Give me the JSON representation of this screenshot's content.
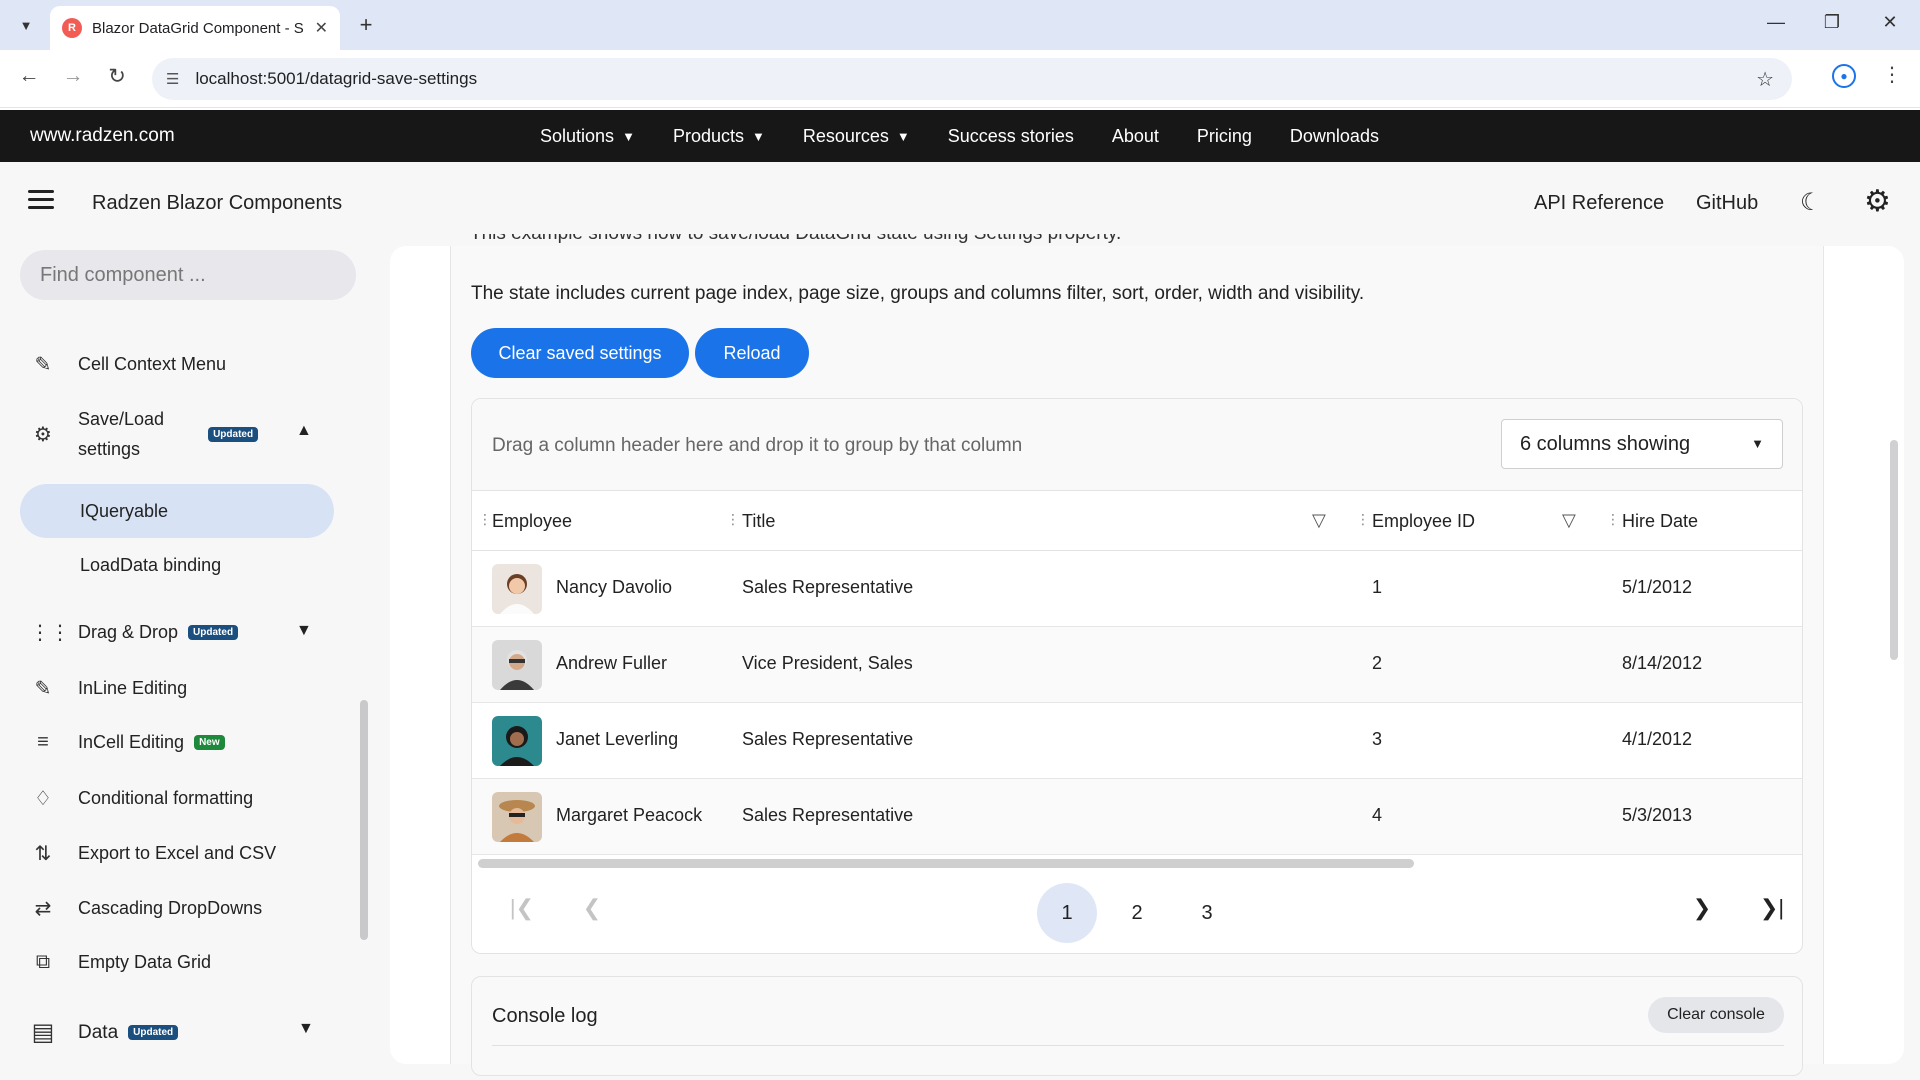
{
  "browser": {
    "tab_title": "Blazor DataGrid Component - S",
    "url": "localhost:5001/datagrid-save-settings"
  },
  "site": {
    "brand": "www.radzen.com",
    "menu": [
      "Solutions",
      "Products",
      "Resources",
      "Success stories",
      "About",
      "Pricing",
      "Downloads"
    ]
  },
  "header": {
    "title": "Radzen Blazor Components",
    "api_reference": "API Reference",
    "github": "GitHub"
  },
  "sidebar": {
    "search_placeholder": "Find component ...",
    "items": {
      "cell_context_menu": "Cell Context Menu",
      "save_load_line1": "Save/Load",
      "save_load_line2": "settings",
      "iqueryable": "IQueryable",
      "loaddata_binding": "LoadData binding",
      "drag_drop": "Drag & Drop",
      "inline_editing": "InLine Editing",
      "incell_editing": "InCell Editing",
      "conditional_formatting": "Conditional formatting",
      "export_excel_csv": "Export to Excel and CSV",
      "cascading_dropdowns": "Cascading DropDowns",
      "empty_data_grid": "Empty Data Grid",
      "data": "Data"
    },
    "badges": {
      "updated": "Updated",
      "new": "New"
    }
  },
  "main": {
    "cut_text": "This example shows how to save/load DataGrid state using Settings property.",
    "description": "The state includes current page index, page size, groups and columns filter, sort, order, width and visibility.",
    "clear_button": "Clear saved settings",
    "reload_button": "Reload"
  },
  "grid": {
    "group_hint": "Drag a column header here and drop it to group by that column",
    "columns_showing": "6 columns showing",
    "headers": {
      "employee": "Employee",
      "title": "Title",
      "employee_id": "Employee ID",
      "hire_date": "Hire Date"
    },
    "rows": [
      {
        "name": "Nancy Davolio",
        "title": "Sales Representative",
        "id": "1",
        "hire": "5/1/2012"
      },
      {
        "name": "Andrew Fuller",
        "title": "Vice President, Sales",
        "id": "2",
        "hire": "8/14/2012"
      },
      {
        "name": "Janet Leverling",
        "title": "Sales Representative",
        "id": "3",
        "hire": "4/1/2012"
      },
      {
        "name": "Margaret Peacock",
        "title": "Sales Representative",
        "id": "4",
        "hire": "5/3/2013"
      }
    ],
    "pages": [
      "1",
      "2",
      "3"
    ],
    "current_page": "1"
  },
  "console": {
    "title": "Console log",
    "clear": "Clear console"
  },
  "colors": {
    "accent": "#1a73e8",
    "sitebar": "#171717",
    "badge_updated": "#1a4f80",
    "badge_new": "#1c8a3a"
  }
}
